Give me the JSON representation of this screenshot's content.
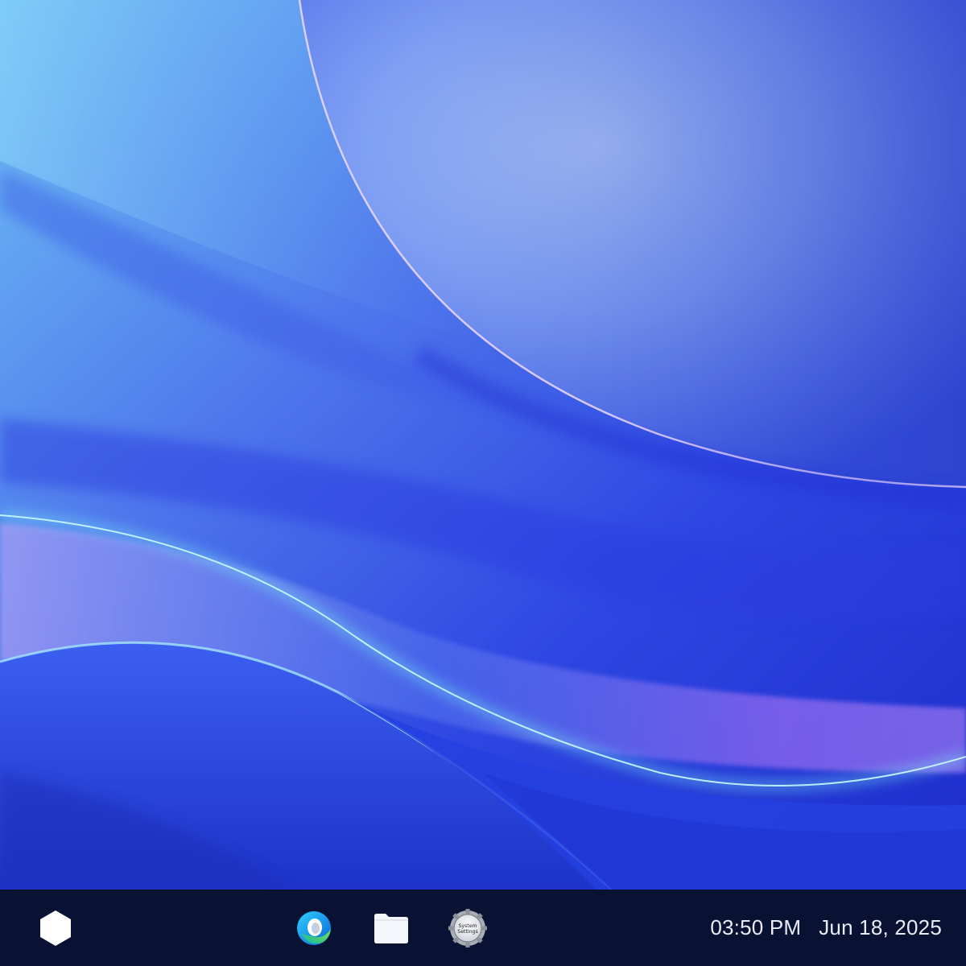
{
  "desktop": {
    "wallpaper": "blue-abstract-waves-wallpaper",
    "colors": {
      "base": "#2f4fe0",
      "light_blue": "#7fb6f6",
      "deep_blue": "#2130d8",
      "cyan_glow": "#8ff4f6",
      "violet": "#a879f3"
    }
  },
  "taskbar": {
    "background": "#0a1233",
    "apps": [
      {
        "id": "launcher",
        "icon": "hexagon-launcher-icon"
      },
      {
        "id": "browser",
        "icon": "browser-icon"
      },
      {
        "id": "files",
        "icon": "folder-icon"
      },
      {
        "id": "settings",
        "icon": "settings-gear-icon",
        "label_line1": "System",
        "label_line2": "Settings"
      }
    ],
    "clock": {
      "time": "03:50 PM",
      "date": "Jun 18, 2025"
    }
  }
}
